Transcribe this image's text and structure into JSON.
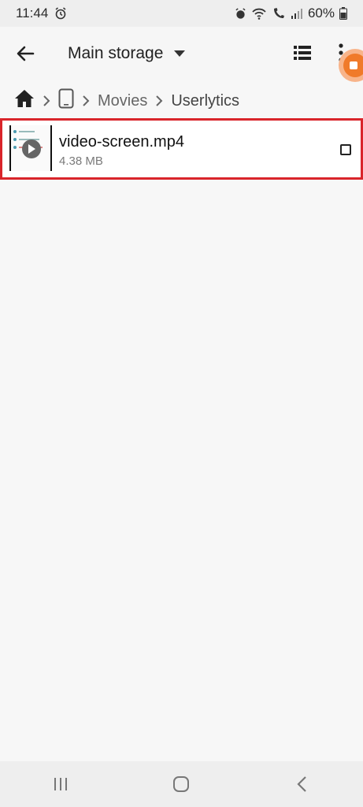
{
  "status_bar": {
    "time": "11:44",
    "battery_percent": "60%",
    "icons": [
      "alarm-icon",
      "wifi-icon",
      "call-icon",
      "signal-icon",
      "battery-icon"
    ]
  },
  "toolbar": {
    "title": "Main storage",
    "icons": [
      "back-arrow-icon",
      "dropdown-triangle-icon",
      "list-view-icon",
      "more-vert-icon",
      "screen-record-icon"
    ]
  },
  "breadcrumb": {
    "items": [
      "Movies",
      "Userlytics"
    ]
  },
  "files": [
    {
      "name": "video-screen.mp4",
      "size": "4.38 MB"
    }
  ],
  "colors": {
    "highlight_border": "#d9252b",
    "record_bubble": "#f07a2a"
  }
}
